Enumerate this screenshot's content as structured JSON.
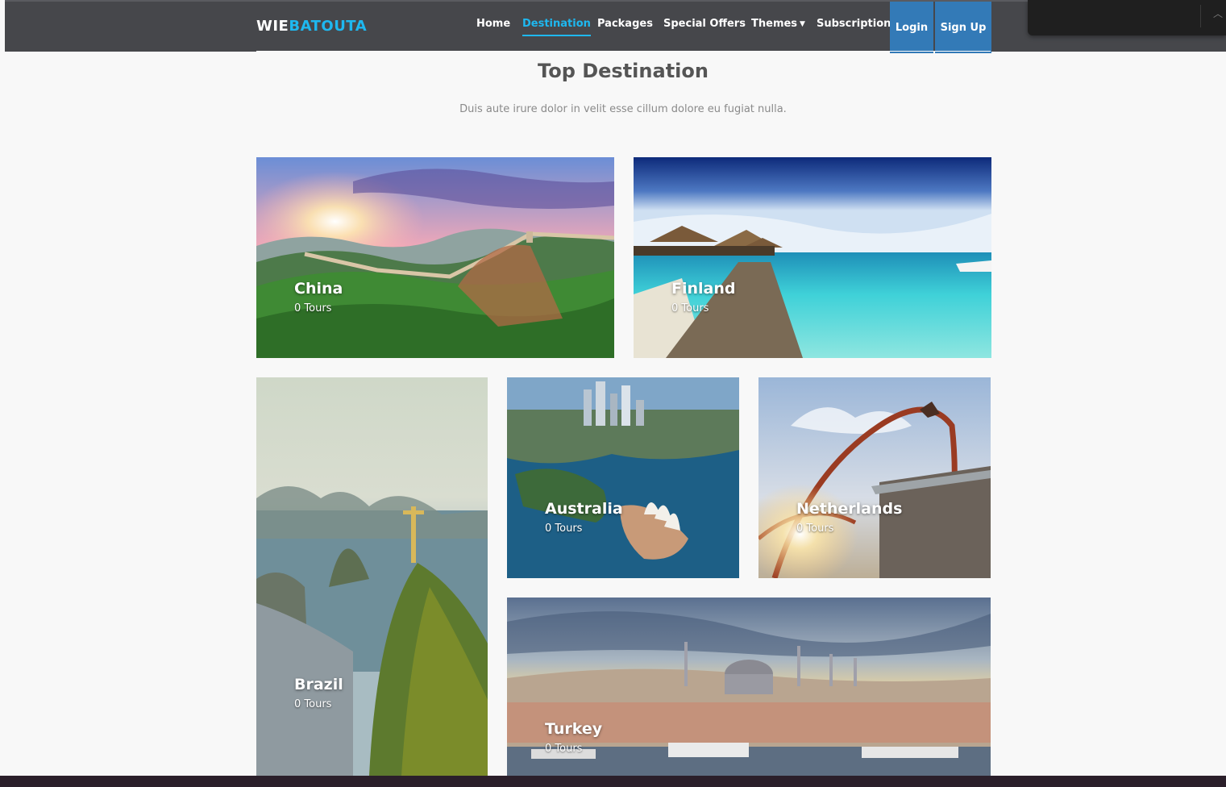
{
  "brand": {
    "part1": "WIE",
    "part2": "BATOUTA"
  },
  "nav": {
    "items": [
      "Home",
      "Destination",
      "Packages",
      "Special Offers",
      "Themes",
      "Subscription"
    ],
    "login": "Login",
    "signup": "Sign Up"
  },
  "section": {
    "title": "Top Destination",
    "subtitle": "Duis aute irure dolor in velit esse cillum dolore eu fugiat nulla."
  },
  "destinations": [
    {
      "name": "China",
      "tours": "0 Tours"
    },
    {
      "name": "Finland",
      "tours": "0 Tours"
    },
    {
      "name": "Brazil",
      "tours": "0 Tours"
    },
    {
      "name": "Australia",
      "tours": "0 Tours"
    },
    {
      "name": "Netherlands",
      "tours": "0 Tours"
    },
    {
      "name": "Turkey",
      "tours": "0 Tours"
    }
  ],
  "colors": {
    "accent": "#1eb8f0",
    "button": "#337ab7",
    "navbar": "#46474b"
  },
  "icons": {
    "themes_dropdown": "caret-down-icon",
    "panel_toggle": "chevron-up-icon"
  }
}
